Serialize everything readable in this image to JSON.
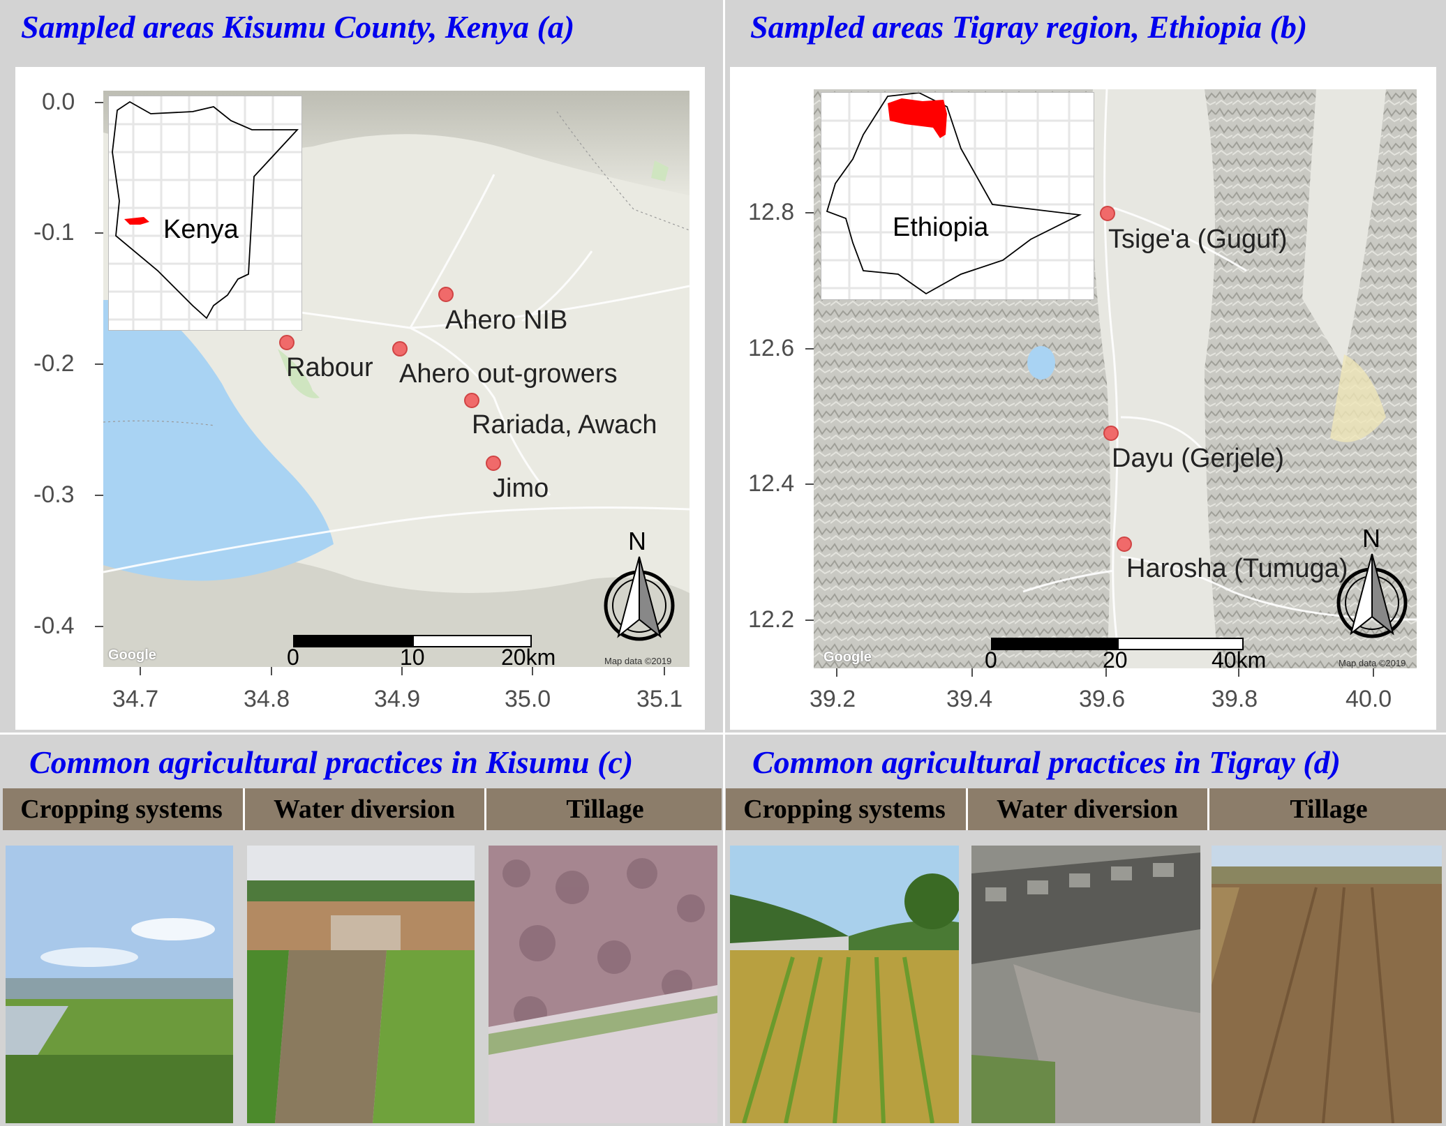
{
  "panels": {
    "a": {
      "title": "Sampled areas Kisumu County, Kenya (a)",
      "x_ticks": [
        "34.7",
        "34.8",
        "34.9",
        "35.0",
        "35.1"
      ],
      "y_ticks": [
        "0.0",
        "-0.1",
        "-0.2",
        "-0.3",
        "-0.4"
      ],
      "inset_label": "Kenya",
      "sites": [
        "Ahero NIB",
        "Rabour",
        "Ahero out-growers",
        "Rariada, Awach",
        "Jimo"
      ],
      "scale": [
        "0",
        "10",
        "20km"
      ],
      "north": "N",
      "google": "Google",
      "attribution": "Map data ©2019"
    },
    "b": {
      "title": "Sampled areas Tigray region, Ethiopia (b)",
      "x_ticks": [
        "39.2",
        "39.4",
        "39.6",
        "39.8",
        "40.0"
      ],
      "y_ticks": [
        "12.8",
        "12.6",
        "12.4",
        "12.2"
      ],
      "inset_label": "Ethiopia",
      "sites": [
        "Tsige'a (Guguf)",
        "Dayu (Gerjele)",
        "Harosha (Tumuga)"
      ],
      "scale": [
        "0",
        "20",
        "40km"
      ],
      "north": "N",
      "google": "Google",
      "attribution": "Map data ©2019"
    },
    "c": {
      "title": "Common agricultural practices in Kisumu (c)",
      "headers": [
        "Cropping systems",
        "Water diversion",
        "Tillage"
      ]
    },
    "d": {
      "title": "Common agricultural practices in Tigray (d)",
      "headers": [
        "Cropping systems",
        "Water diversion",
        "Tillage"
      ]
    }
  },
  "colors": {
    "title": "#0000ee",
    "site_point": "#f06a6a",
    "header_bg": "#8c7d6a"
  }
}
